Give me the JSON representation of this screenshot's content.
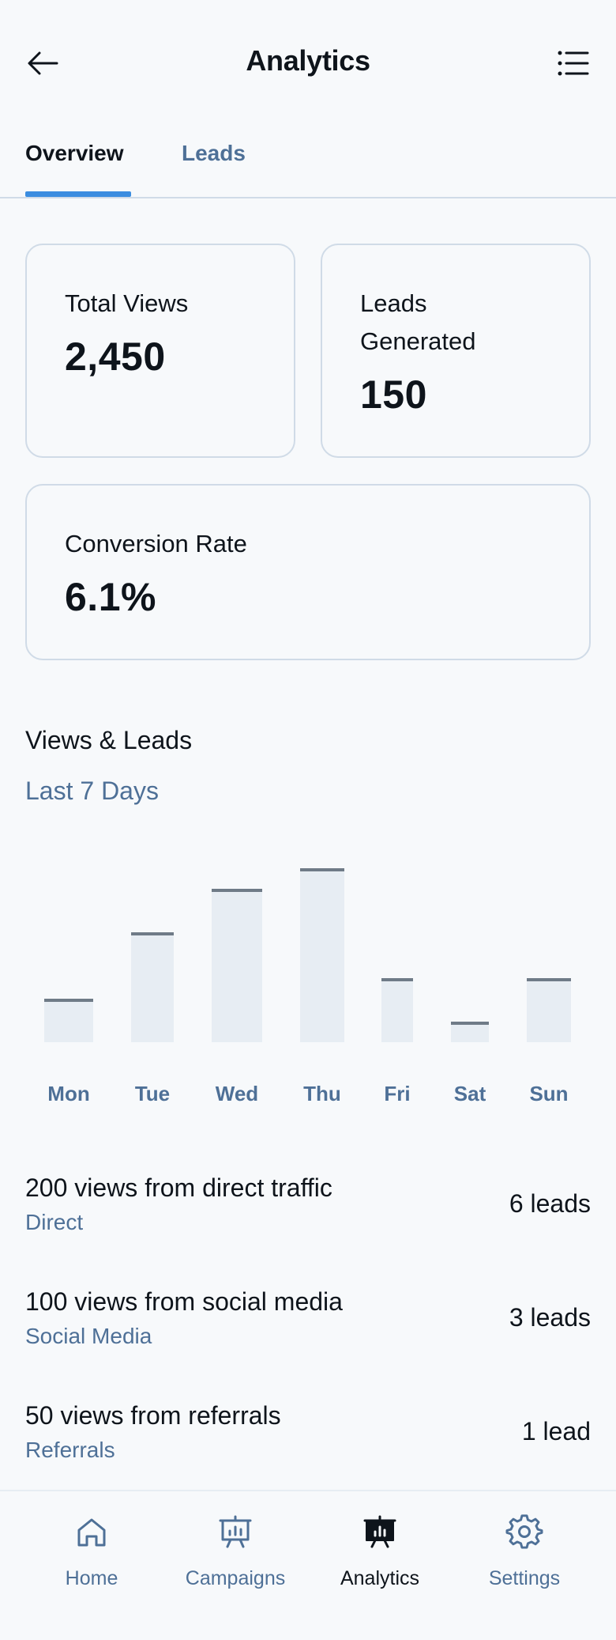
{
  "header": {
    "title": "Analytics",
    "back_icon": "arrow-left-icon",
    "menu_icon": "list-icon"
  },
  "tabs": [
    {
      "label": "Overview",
      "active": true
    },
    {
      "label": "Leads",
      "active": false
    }
  ],
  "stats": {
    "total_views": {
      "label": "Total Views",
      "value": "2,450"
    },
    "leads_generated": {
      "label_line1": "Leads",
      "label_line2": "Generated",
      "value": "150"
    },
    "conversion_rate": {
      "label": "Conversion Rate",
      "value": "6.1%"
    }
  },
  "chart_section": {
    "title": "Views & Leads",
    "subtitle": "Last 7 Days"
  },
  "chart_data": {
    "type": "bar",
    "categories": [
      "Mon",
      "Tue",
      "Wed",
      "Thu",
      "Fri",
      "Sat",
      "Sun"
    ],
    "values": [
      25,
      63,
      88,
      100,
      37,
      12,
      37
    ],
    "ylim": [
      0,
      100
    ],
    "grid": false,
    "legend": "none"
  },
  "sources": [
    {
      "title": "200 views from direct traffic",
      "subtitle": "Direct",
      "leads": "6 leads"
    },
    {
      "title": "100 views from social media",
      "subtitle": "Social Media",
      "leads": "3 leads"
    },
    {
      "title": "50 views from referrals",
      "subtitle": "Referrals",
      "leads": "1 lead"
    }
  ],
  "bottom_nav": [
    {
      "label": "Home",
      "icon": "home-icon",
      "active": false
    },
    {
      "label": "Campaigns",
      "icon": "presentation-chart-icon",
      "active": false
    },
    {
      "label": "Analytics",
      "icon": "presentation-chart-filled-icon",
      "active": true
    },
    {
      "label": "Settings",
      "icon": "gear-icon",
      "active": false
    }
  ],
  "colors": {
    "accent": "#3b8de0",
    "muted_text": "#4e7097",
    "border": "#d0dbe7",
    "bar_fill": "#e7edf3",
    "bar_cap": "#6f7b87"
  }
}
